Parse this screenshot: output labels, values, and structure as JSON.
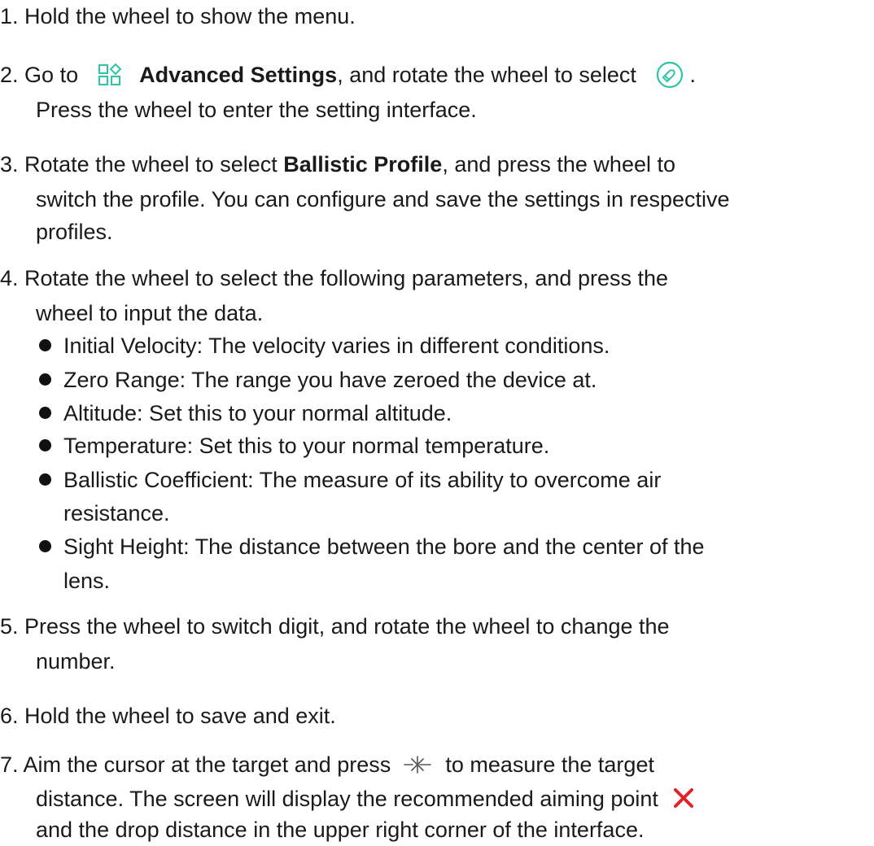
{
  "colors": {
    "accent": "#2bc4a6",
    "cross": "#e0232a",
    "text": "#1a1a1a"
  },
  "steps": [
    {
      "num": "1.",
      "text": "Hold the wheel to show the menu."
    },
    {
      "num": "2.",
      "before": "Go to",
      "icon1": "advanced-settings-grid-icon",
      "bold": "Advanced Settings",
      "middle": ", and rotate the wheel to select",
      "icon2": "ballistic-bullet-icon",
      "after": ".",
      "line2": "Press the wheel to enter the setting interface."
    },
    {
      "num": "3.",
      "before": "Rotate the wheel to select ",
      "bold": "Ballistic Profile",
      "after": ", and press the wheel to",
      "line2": "switch the profile. You can configure and save the settings in respective",
      "line3": "profiles."
    },
    {
      "num": "4.",
      "text": "Rotate the wheel to select the following parameters, and press the",
      "line2": "wheel to input the data.",
      "bullets": [
        {
          "text": "Initial Velocity: The velocity varies in different conditions."
        },
        {
          "text": "Zero Range: The range you have zeroed the device at."
        },
        {
          "text": "Altitude: Set this to your normal altitude."
        },
        {
          "text": "Temperature: Set this to your normal temperature."
        },
        {
          "text": "Ballistic Coefficient: The measure of its ability to overcome air",
          "cont": "resistance."
        },
        {
          "text": "Sight Height: The distance between the bore and the center of the",
          "cont": "lens."
        }
      ]
    },
    {
      "num": "5.",
      "text": "Press the wheel to switch digit, and rotate the wheel to change the",
      "line2": "number."
    },
    {
      "num": "6.",
      "text": "Hold the wheel to save and exit."
    },
    {
      "num": "7.",
      "before": "Aim the cursor at the target and press",
      "icon1": "laser-range-icon",
      "after": "to measure the target",
      "line2": "distance. The screen will display the recommended aiming point",
      "icon2": "aiming-point-cross-icon",
      "line3": "and the drop distance in the upper right corner of the interface."
    }
  ]
}
